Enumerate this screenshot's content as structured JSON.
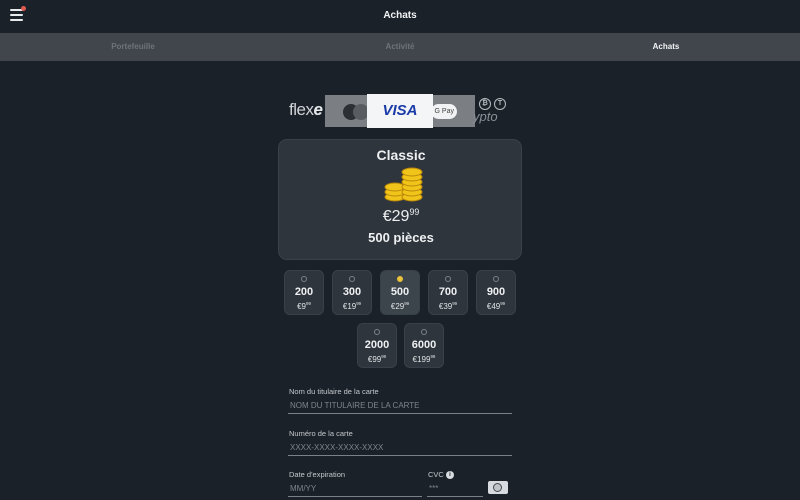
{
  "topbar": {
    "title": "Achats"
  },
  "tabs": [
    {
      "label": "Portefeuille",
      "active": false
    },
    {
      "label": "Activité",
      "active": false
    },
    {
      "label": "Achats",
      "active": true
    }
  ],
  "payment_methods": {
    "flex_text": "flex",
    "flex_suffix": "e",
    "visa_label": "VISA",
    "gpay_label": "G Pay",
    "crypto_label": "ypto",
    "crypto_coins": [
      "₿",
      "T"
    ],
    "selected": "VISA"
  },
  "selected_pack": {
    "name": "Classic",
    "price_main": "€29",
    "price_cents": "99",
    "quantity_label": "500 pièces"
  },
  "options": [
    {
      "qty": "200",
      "price_main": "€9",
      "price_cents": "99",
      "selected": false
    },
    {
      "qty": "300",
      "price_main": "€19",
      "price_cents": "99",
      "selected": false
    },
    {
      "qty": "500",
      "price_main": "€29",
      "price_cents": "99",
      "selected": true
    },
    {
      "qty": "700",
      "price_main": "€39",
      "price_cents": "99",
      "selected": false
    },
    {
      "qty": "900",
      "price_main": "€49",
      "price_cents": "99",
      "selected": false
    },
    {
      "qty": "2000",
      "price_main": "€99",
      "price_cents": "99",
      "selected": false
    },
    {
      "qty": "6000",
      "price_main": "€199",
      "price_cents": "99",
      "selected": false
    }
  ],
  "form": {
    "holder_label": "Nom du titulaire de la carte",
    "holder_placeholder": "NOM DU TITULAIRE DE LA CARTE",
    "number_label": "Numéro de la carte",
    "number_placeholder": "XXXX-XXXX-XXXX-XXXX",
    "expiry_label": "Date d'expiration",
    "expiry_placeholder": "MM/YY",
    "cvc_label": "CVC",
    "cvc_placeholder": "***"
  },
  "colors": {
    "background": "#1b2128",
    "card": "#2e353c",
    "accent_gold": "#e9c33b",
    "visa_blue": "#1a3aa8",
    "notification": "#e0584f"
  }
}
